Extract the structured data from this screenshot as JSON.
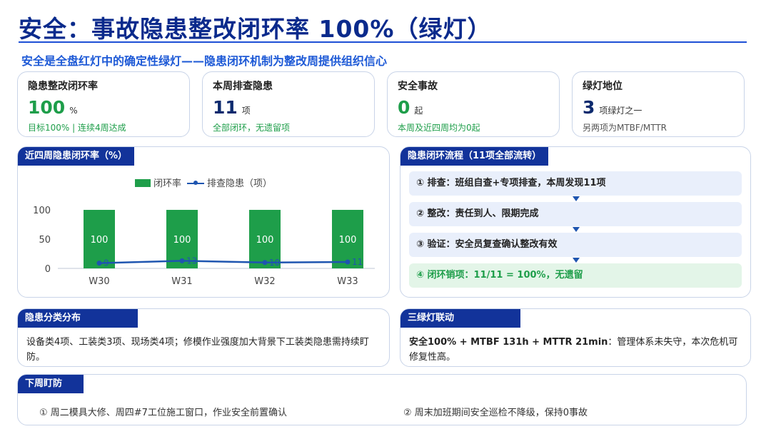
{
  "title": "安全：事故隐患整改闭环率 100%（绿灯）",
  "subtitle": "安全是全盘红灯中的确定性绿灯——隐患闭环机制为整改周提供组织信心",
  "kpis": [
    {
      "label": "隐患整改闭环率",
      "value": "100",
      "unit": "%",
      "note": "目标100% | 连续4周达成"
    },
    {
      "label": "本周排查隐患",
      "value": "11",
      "unit": "项",
      "note": "全部闭环，无遗留项"
    },
    {
      "label": "安全事故",
      "value": "0",
      "unit": "起",
      "note": "本周及近四周均为0起"
    },
    {
      "label": "绿灯地位",
      "value": "3",
      "unit": "项绿灯之一",
      "note": "另两项为MTBF/MTTR"
    }
  ],
  "chart_panel": {
    "title": "近四周隐患闭环率（%）"
  },
  "chart_data": {
    "type": "bar",
    "categories": [
      "W30",
      "W31",
      "W32",
      "W33"
    ],
    "series": [
      {
        "name": "闭环率",
        "type": "bar",
        "values": [
          100,
          100,
          100,
          100
        ],
        "color": "#1e9e4a"
      },
      {
        "name": "排查隐患（项）",
        "type": "line",
        "values": [
          9,
          13,
          10,
          11
        ],
        "color": "#1e55b0"
      }
    ],
    "ylim": [
      0,
      100
    ],
    "yticks": [
      0,
      50,
      100
    ],
    "legend": "top-center",
    "grid": false
  },
  "flow_panel": {
    "title": "隐患闭环流程（11项全部流转）",
    "steps": [
      "① 排查：班组自查+专项排查，本周发现11项",
      "② 整改：责任到人、限期完成",
      "③ 验证：安全员复查确认整改有效",
      "④ 闭环销项：11/11 = 100%，无遗留"
    ]
  },
  "distribution": {
    "title": "隐患分类分布",
    "text": "设备类4项、工装类3项、现场类4项；修模作业强度加大背景下工装类隐患需持续盯防。"
  },
  "linkage": {
    "title": "三绿灯联动",
    "bold": "安全100% + MTBF 131h + MTTR 21min",
    "text": "：管理体系未失守，本次危机可修复性高。"
  },
  "next_week": {
    "title": "下周盯防",
    "items": [
      "① 周二模具大修、周四#7工位施工窗口，作业安全前置确认",
      "② 周末加班期间安全巡检不降级，保持0事故"
    ]
  },
  "colors": {
    "navy": "#12339a",
    "green": "#1e9e4a",
    "line": "#1e55b0"
  }
}
